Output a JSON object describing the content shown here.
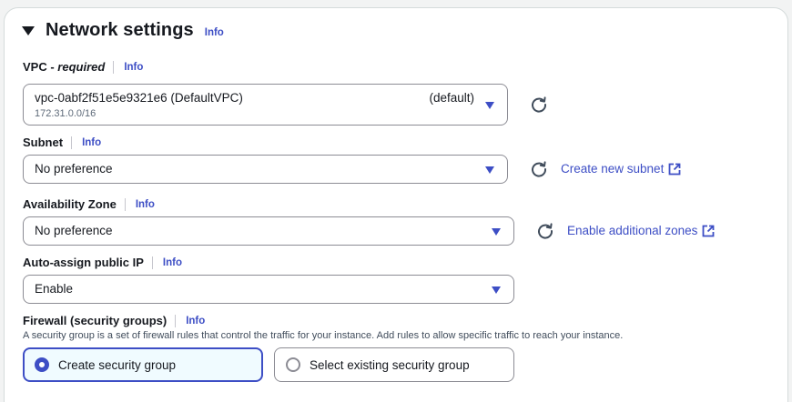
{
  "section": {
    "title": "Network settings",
    "info": "Info"
  },
  "vpc": {
    "label": "VPC - ",
    "label_required": "required",
    "info": "Info",
    "value": "vpc-0abf2f51e5e9321e6 (DefaultVPC)",
    "tag": "(default)",
    "cidr": "172.31.0.0/16"
  },
  "subnet": {
    "label": "Subnet",
    "info": "Info",
    "value": "No preference",
    "create_link": "Create new subnet"
  },
  "availability_zone": {
    "label": "Availability Zone",
    "info": "Info",
    "value": "No preference",
    "enable_link": "Enable additional zones"
  },
  "public_ip": {
    "label": "Auto-assign public IP",
    "info": "Info",
    "value": "Enable"
  },
  "firewall": {
    "label": "Firewall (security groups)",
    "info": "Info",
    "description": "A security group is a set of firewall rules that control the traffic for your instance. Add rules to allow specific traffic to reach your instance.",
    "options": [
      {
        "label": "Create security group",
        "selected": true
      },
      {
        "label": "Select existing security group",
        "selected": false
      }
    ]
  },
  "colors": {
    "accent": "#3d4ec5",
    "border": "#8c8c94",
    "text": "#16191f",
    "selected_bg": "#f0fbff"
  },
  "icons": {
    "caret": "caret-down-icon",
    "refresh": "refresh-icon",
    "external": "external-link-icon",
    "dropdown": "dropdown-triangle-icon"
  }
}
